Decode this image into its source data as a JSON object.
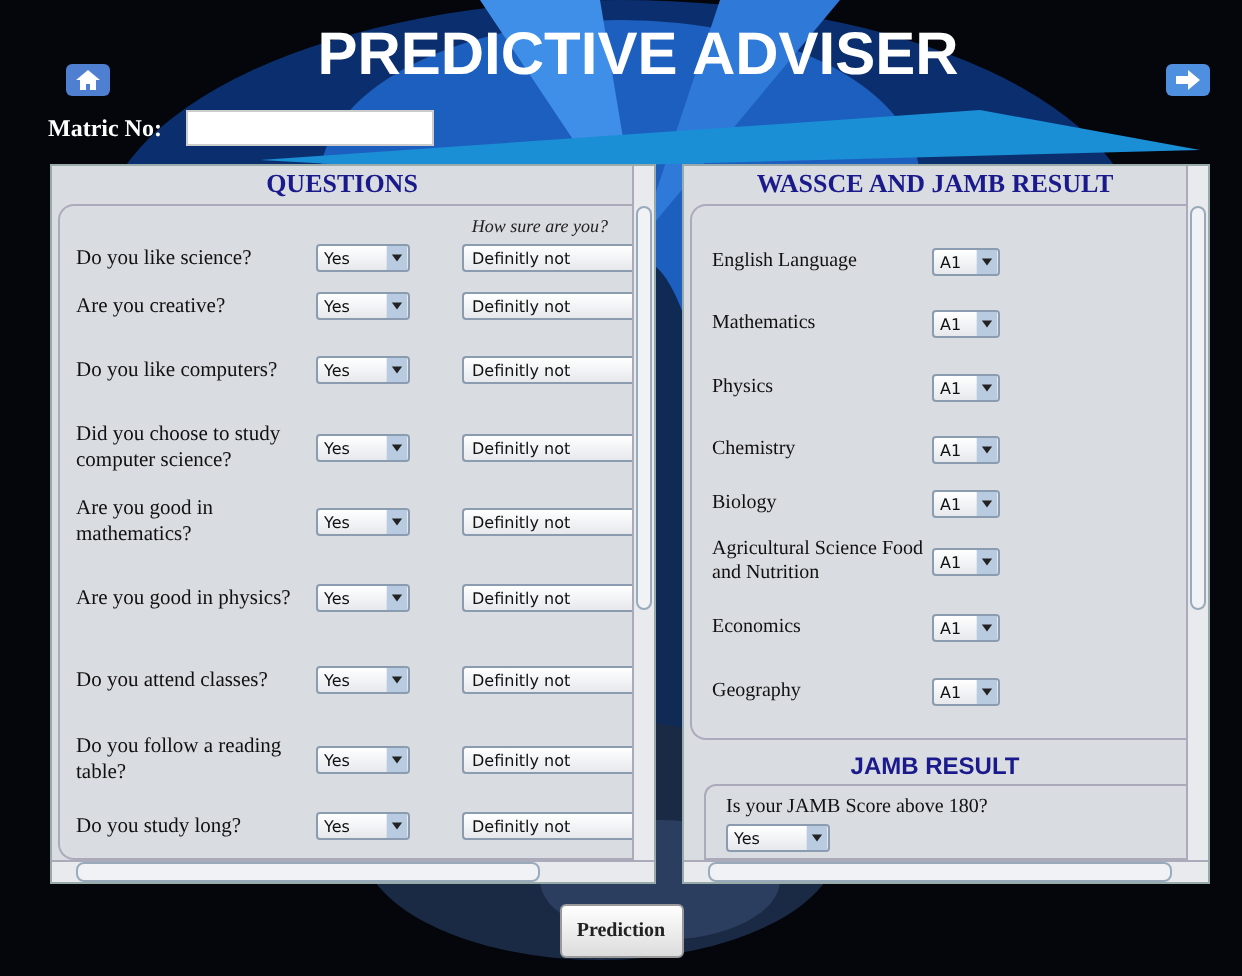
{
  "header": {
    "title": "PREDICTIVE ADVISER"
  },
  "matric": {
    "label": "Matric No:"
  },
  "questions": {
    "title": "QUESTIONS",
    "certainty_heading": "How sure are you?",
    "rows": [
      {
        "question": "Do you like science?",
        "answer": "Yes",
        "certainty": "Definitly not"
      },
      {
        "question": "Are you creative?",
        "answer": "Yes",
        "certainty": "Definitly not"
      },
      {
        "question": "Do you like computers?",
        "answer": "Yes",
        "certainty": "Definitly not"
      },
      {
        "question": "Did you choose to study computer science?",
        "answer": "Yes",
        "certainty": "Definitly not"
      },
      {
        "question": "Are you good in mathematics?",
        "answer": "Yes",
        "certainty": "Definitly not"
      },
      {
        "question": "Are you good in physics?",
        "answer": "Yes",
        "certainty": "Definitly not"
      },
      {
        "question": "Do you attend classes?",
        "answer": "Yes",
        "certainty": "Definitly not"
      },
      {
        "question": "Do you follow a reading table?",
        "answer": "Yes",
        "certainty": "Definitly not"
      },
      {
        "question": "Do you study long?",
        "answer": "Yes",
        "certainty": "Definitly not"
      }
    ]
  },
  "results": {
    "title": "WASSCE AND JAMB RESULT",
    "subjects": [
      {
        "name": "English Language",
        "grade": "A1"
      },
      {
        "name": "Mathematics",
        "grade": "A1"
      },
      {
        "name": "Physics",
        "grade": "A1"
      },
      {
        "name": "Chemistry",
        "grade": "A1"
      },
      {
        "name": "Biology",
        "grade": "A1"
      },
      {
        "name": "Agricultural Science Food and Nutrition",
        "grade": "A1"
      },
      {
        "name": "Economics",
        "grade": "A1"
      },
      {
        "name": "Geography",
        "grade": "A1"
      }
    ],
    "jamb": {
      "title": "JAMB RESULT",
      "question": "Is your JAMB Score above 180?",
      "answer": "Yes"
    }
  },
  "button": {
    "label": "Prediction"
  }
}
